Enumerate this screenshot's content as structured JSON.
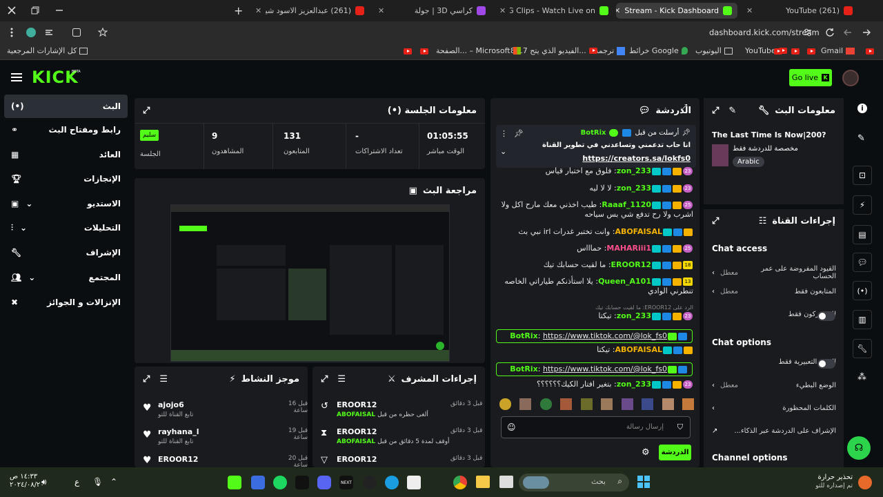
{
  "browser": {
    "tabs": [
      {
        "label": "(261) YouTube"
      },
      {
        "label": "Stream - Kick Dashboard"
      },
      {
        "label": "3MARING Clips - Watch Live on"
      },
      {
        "label": "كراسي 3D | جولة"
      },
      {
        "label": "(261) عبدالعزيز الاسود شيطانه"
      }
    ],
    "new_tab": "+",
    "url": "dashboard.kick.com/stream",
    "bookmarks": [
      "Gmail",
      "YouTube",
      "اليوتيوب",
      "خرائط Google",
      "ترجمة",
      "8:17 الفيديو الذي يتح...",
      "الصفحة... – Microsoft",
      "كل الإشارات المرجعية"
    ]
  },
  "header": {
    "logo": "KICK",
    "logo_sup": "BETA",
    "go_live": "Go live"
  },
  "sidebar": {
    "items": [
      {
        "label": "البث",
        "icon": "broadcast-icon"
      },
      {
        "label": "رابط ومفتاح البث",
        "icon": "link-icon"
      },
      {
        "label": "العائد",
        "icon": "revenue-icon"
      },
      {
        "label": "الإنجازات",
        "icon": "trophy-icon"
      },
      {
        "label": "الاستديو",
        "icon": "studio-icon"
      },
      {
        "label": "التحليلات",
        "icon": "analytics-icon"
      },
      {
        "label": "الإشراف",
        "icon": "wrench-icon"
      },
      {
        "label": "المجتمع",
        "icon": "community-icon"
      },
      {
        "label": "الإنزالات و الجوائز",
        "icon": "gift-icon"
      }
    ]
  },
  "session": {
    "title": "معلومات الجلسة",
    "status_badge": "سليم",
    "stats": [
      {
        "label": "الوقت مباشر",
        "value": "01:05:55"
      },
      {
        "label": "تعداد الاشتراكات",
        "value": "-"
      },
      {
        "label": "المتابعون",
        "value": "131"
      },
      {
        "label": "المشاهدون",
        "value": "9"
      },
      {
        "label": "الجلسة",
        "value": ""
      }
    ]
  },
  "preview": {
    "title": "مراجعة البث"
  },
  "activity": {
    "title": "موجز النشاط",
    "items": [
      {
        "user": "ajojo6",
        "desc": "تابع القناة للتو",
        "time": "قبل 16 ساعة",
        "icon": "heart-icon"
      },
      {
        "user": "rayhana_l",
        "desc": "تابع القناة للتو",
        "time": "قبل 19 ساعة",
        "icon": "heart-icon"
      },
      {
        "user": "EROOR12",
        "desc": "",
        "time": "قبل 20 ساعة",
        "icon": "heart-icon"
      }
    ]
  },
  "mod": {
    "title": "إجراءات المشرف",
    "items": [
      {
        "user": "EROOR12",
        "desc": "ألغى حظره من قبل",
        "by": "ABOFAISAL",
        "time": "قبل 3 دقائق"
      },
      {
        "user": "EROOR12",
        "desc": "أوقف لمدة 5 دقائق من قبل",
        "by": "ABOFAISAL",
        "time": "قبل 3 دقائق"
      },
      {
        "user": "EROOR12",
        "desc": "",
        "by": "",
        "time": "قبل 3 دقائق"
      }
    ]
  },
  "chat": {
    "title": "الدردشة",
    "pinned": {
      "pinned_by": "أرسلت من قبل",
      "user": "BotRix",
      "text": "انا حاب تدعمني وتساعدني في تطوير القناة",
      "link": "https://creators.sa/lokfs0"
    },
    "messages": [
      {
        "user": "zon_233",
        "level": "23",
        "text": "فلوق مع اختبار قياس",
        "color": "#53fc18"
      },
      {
        "user": "zon_233",
        "level": "23",
        "text": "لا لا ليه",
        "color": "#53fc18"
      },
      {
        "user": "Raaaf_1120",
        "level": "25",
        "text": "طيب اخذني معك مارح اكل ولا اشرب ولا رح تدفع شي بس سياحه",
        "color": "#53fc18"
      },
      {
        "user": "ABOFAISAL",
        "level": "",
        "text": "وانت تختبر غدرات irl نبي بث",
        "color": "#f5b300"
      },
      {
        "user": "MAHARiii1",
        "level": "25",
        "text": "حماااس",
        "color": "#ff4f8b"
      },
      {
        "user": "EROOR12",
        "level": "18",
        "text": "ما لقيت حسابك تيك",
        "color": "#53fc18"
      },
      {
        "user": "Queen_A101",
        "level": "13",
        "text": "يلا استأذنكم طياراتي الخاصه تنطرني الوادي",
        "color": "#53fc18"
      },
      {
        "user": "zon_233",
        "level": "23",
        "text": "تيكتا",
        "color": "#53fc18",
        "reply": "الرد على EROOR12: ما لقيت حسابك تيك"
      },
      {
        "user": "BotRix",
        "level": "",
        "text": "https://www.tiktok.com/@lok_fs0",
        "color": "#53fc18"
      },
      {
        "user": "ABOFAISAL",
        "level": "",
        "text": "تيكتا",
        "color": "#f5b300"
      },
      {
        "user": "BotRix",
        "level": "",
        "text": "https://www.tiktok.com/@lok_fs0",
        "color": "#53fc18"
      },
      {
        "user": "zon_233",
        "level": "23",
        "text": "بتغير افتار الكيك؟؟؟؟؟؟",
        "color": "#53fc18"
      }
    ],
    "input_placeholder": "إرسال رسالة",
    "send": "الدردشة"
  },
  "stream_info": {
    "title": "معلومات البث",
    "stream_title": "The Last Time Is Now|200?",
    "category": "مخصصة للدردشة فقط",
    "language": "Arabic"
  },
  "channel_actions": {
    "title": "إجراءات القناة",
    "chat_access": "Chat access",
    "access_rows": [
      {
        "label": "القيود المفروضة على عمر الحساب",
        "value": "معطل",
        "type": "arrow"
      },
      {
        "label": "المتابعون فقط",
        "value": "معطل",
        "type": "arrow"
      },
      {
        "label": "للمشتركون فقط",
        "value": "",
        "type": "toggle"
      }
    ],
    "chat_options": "Chat options",
    "option_rows": [
      {
        "label": "الصور التعبيرية فقط",
        "value": "",
        "type": "toggle"
      },
      {
        "label": "الوضع البطيء",
        "value": "معطل",
        "type": "arrow"
      },
      {
        "label": "الكلمات المحظورة",
        "value": "",
        "type": "arrow"
      },
      {
        "label": "الإشراف على الدردشة عبر الذكاء...",
        "value": "",
        "type": "link"
      }
    ],
    "channel_options": "Channel options"
  },
  "taskbar": {
    "search": "بحث",
    "weather": "تحذير حرارة",
    "weather_sub": "تم إصداره للتو",
    "time": "١٤:٣٣ ص",
    "date": "٢٠٢٤/٠٨/٢٠",
    "lang": "ع"
  },
  "colors": {
    "kick_green": "#53fc18",
    "panel": "#191b1f",
    "bg": "#0b0e11"
  }
}
